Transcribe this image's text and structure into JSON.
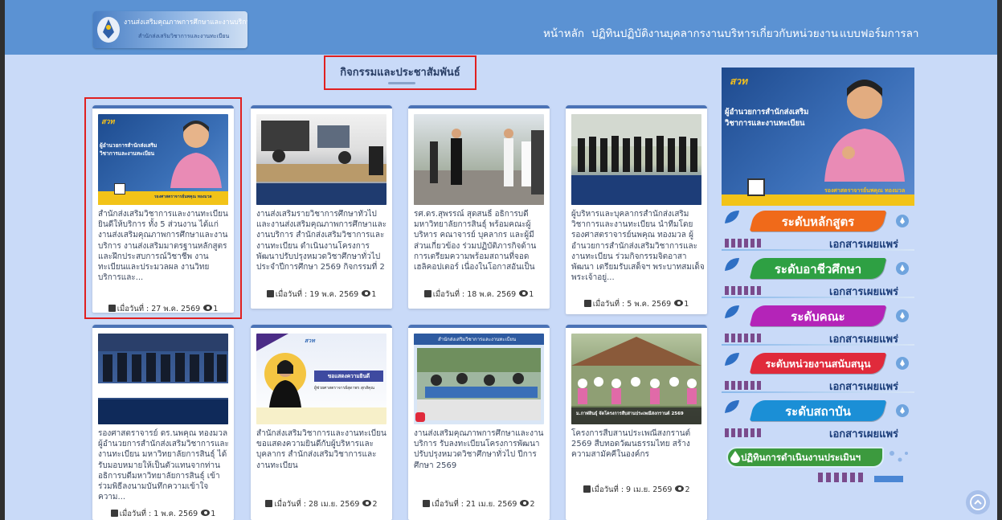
{
  "header": {
    "logo_line1": "งานส่งเสริมคุณภาพการศึกษาและงานบริการ",
    "logo_line2": "สำนักส่งเสริมวิชาการและงานทะเบียน",
    "nav": [
      "หน้าหลัก",
      "ปฏิทินปฏิบัติงาน",
      "บุคลากรงานบริหาร",
      "เกี่ยวกับหน่วยงาน",
      "แบบฟอร์มการลา"
    ]
  },
  "section_title": "กิจกรรมและประชาสัมพันธ์",
  "cards": [
    {
      "desc": "สำนักส่งเสริมวิชาการและงานทะเบียน ยินดีให้บริการ ทั้ง 5 ส่วนงาน ได้แก่งานส่งเสริมคุณภาพการศึกษาและงานบริการ งานส่งเสริมมาตรฐานหลักสูตรและฝึกประสบการณ์วิชาชีพ งานทะเบียนและประมวลผล งานวิทยบริการและ...",
      "date": "เมื่อวันที่ : 27 พ.ค. 2569",
      "views": "1"
    },
    {
      "desc": "งานส่งเสริมรายวิชาการศึกษาทั่วไปและงานส่งเสริมคุณภาพการศึกษาและงานบริการ สำนักส่งเสริมวิชาการและงานทะเบียน ดำเนินงานโครงการพัฒนาปรับปรุงหมวดวิชาศึกษาทั่วไป ประจำปีการศึกษา 2569 กิจกรรมที่ 2 การประ...",
      "date": "เมื่อวันที่ : 19 พ.ค. 2569",
      "views": "1"
    },
    {
      "desc": "รศ.ดร.สุพรรณ์ สุดสนธิ์ อธิการบดีมหาวิทยาลัยการสินธุ์ พร้อมคณะผู้บริหาร คณาจารย์ บุคลากร และผู้มีส่วนเกี่ยวข้อง ร่วมปฏิบัติภารกิจด้านการเตรียมความพร้อมสถานที่จอดเฮลิคอปเตอร์ เนื่องในโอกาสอันเป็นมหามงคล",
      "date": "เมื่อวันที่ : 18 พ.ค. 2569",
      "views": "1"
    },
    {
      "desc": "ผู้บริหารและบุคลากรสำนักส่งเสริมวิชาการและงานทะเบียน นำทีมโดย รองศาสตราจารย์นพคุณ ทองมวล ผู้อำนวยการสำนักส่งเสริมวิชาการและงานทะเบียน ร่วมกิจกรรมจิตอาสาพัฒนา เตรียมรับเสด็จฯ พระบาทสมเด็จพระเจ้าอยู่...",
      "date": "เมื่อวันที่ : 5 พ.ค. 2569",
      "views": "1"
    },
    {
      "desc": "รองศาสตราจารย์ ดร.นพคุณ ทองมวล ผู้อำนวยการสำนักส่งเสริมวิชาการและงานทะเบียน มหาวิทยาลัยการสินธุ์ ได้รับมอบหมายให้เป็นตัวแทนจากท่านอธิการบดีมหาวิทยาลัยการสินธุ์ เข้าร่วมพิธีลงนามบันทึกความเข้าใจความ...",
      "date": "เมื่อวันที่ : 1 พ.ค. 2569",
      "views": "1"
    },
    {
      "desc": "สำนักส่งเสริมวิชาการและงานทะเบียน ขอแสดงความยินดีกับผู้บริหารและบุคลากร สำนักส่งเสริมวิชาการและงานทะเบียน",
      "date": "เมื่อวันที่ : 28 เม.ย. 2569",
      "views": "2"
    },
    {
      "desc": "งานส่งเสริมคุณภาพการศึกษาและงานบริการ รับลงทะเบียนโครงการพัฒนาปรับปรุงหมวดวิชาศึกษาทั่วไป ปีการศึกษา 2569",
      "date": "เมื่อวันที่ : 21 เม.ย. 2569",
      "views": "2"
    },
    {
      "desc": "โครงการสืบสานประเพณีสงกรานต์ 2569 สืบทอดวัฒนธรรมไทย สร้างความสามัคคีในองค์กร",
      "date": "เมื่อวันที่ : 9 เม.ย. 2569",
      "views": "2"
    }
  ],
  "thumbs": {
    "c1_logo": "สวท",
    "c1_line1": "ผู้อำนวยการสำนักส่งเสริม",
    "c1_line2": "วิชาการและงานทะเบียน",
    "c1_name": "รองศาสตราจารย์นพคุณ ทองมวล",
    "c6_text1": "ขอแสดงความยินดี",
    "c6_text2": "ผู้ช่วยศาสตราจารย์สุดาพร สุกสัคุณ",
    "c7_header": "สำนักส่งเสริมวิชาการและงานทะเบียน",
    "c8_caption": "ม.กาฬสินธุ์ จัดโครงการสืบสานประเพณีสงกรานต์ 2569"
  },
  "sidebar": {
    "banner_logo": "สวท",
    "banner_line1": "ผู้อำนวยการสำนักส่งเสริม",
    "banner_line2": "วิชาการและงานทะเบียน",
    "banner_name": "รองศาสตราจารย์นพคุณ ทองมวล",
    "doc_subtitle": "เอกสารเผยแพร่",
    "buttons": [
      {
        "label": "ระดับหลักสูตร",
        "color": "#f06a1a"
      },
      {
        "label": "ระดับอาชีวศึกษา",
        "color": "#2ea043"
      },
      {
        "label": "ระดับคณะ",
        "color": "#b424b8"
      },
      {
        "label": "ระดับหน่วยงานสนับสนุน",
        "color": "#e02a3b"
      },
      {
        "label": "ระดับสถาบัน",
        "color": "#1b8fd6"
      }
    ],
    "last_button": "ปฏิทินการดำเนินงานประเมินฯ"
  }
}
